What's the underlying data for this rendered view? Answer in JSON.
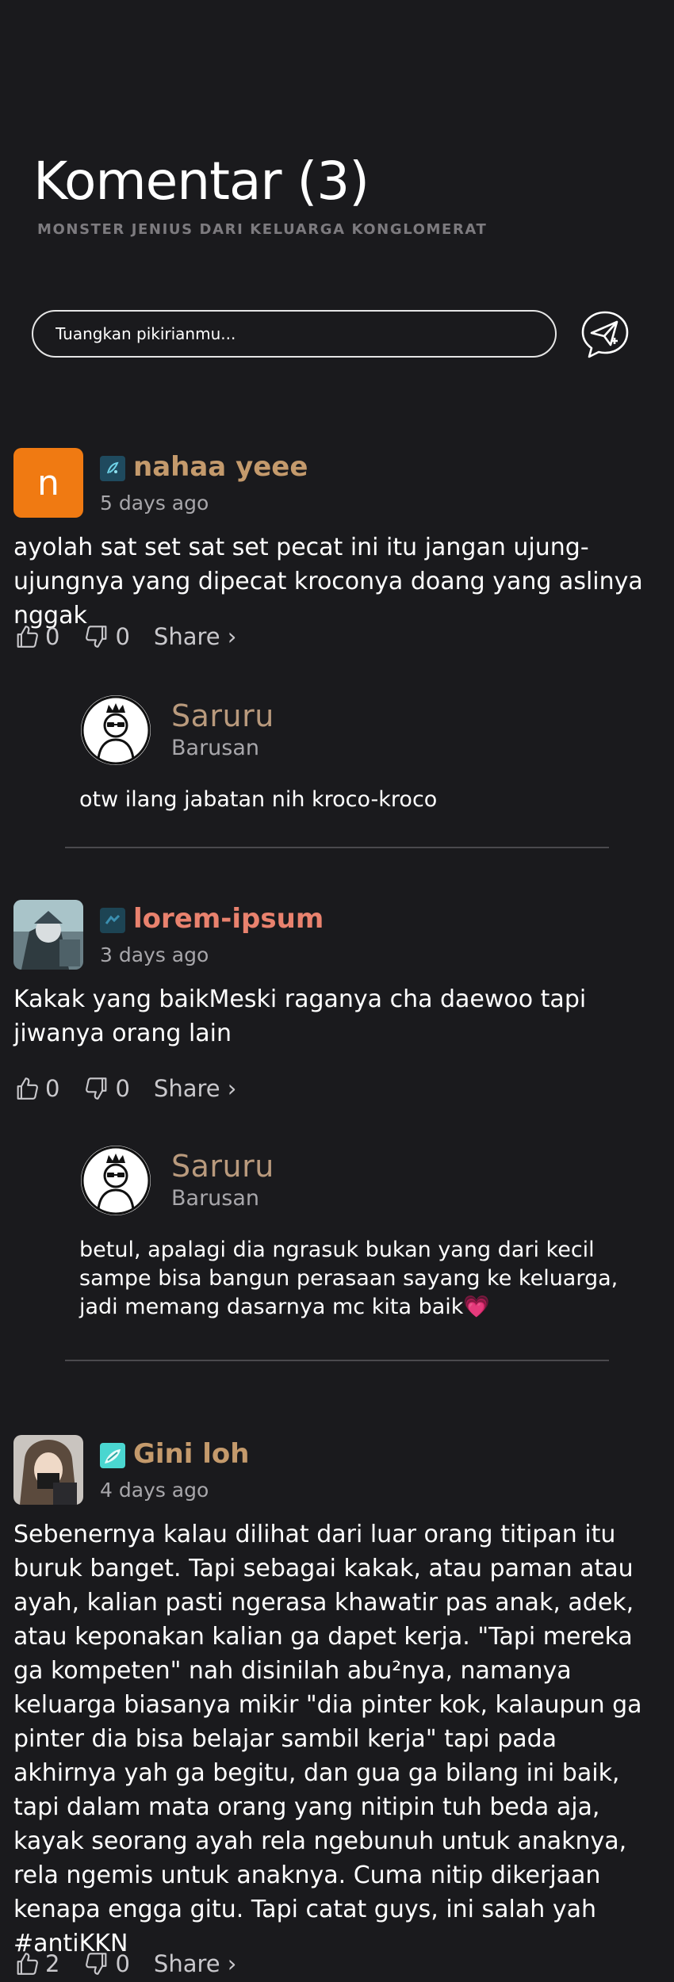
{
  "header": {
    "title": "Komentar (3)",
    "subtitle": "MONSTER JENIUS DARI KELUARGA KONGLOMERAT"
  },
  "composer": {
    "placeholder": "Tuangkan pikirianmu...",
    "send_icon": "send-icon"
  },
  "comments": [
    {
      "avatar_letter": "n",
      "name": "nahaa yeee",
      "name_color": "#c49a6c",
      "time": "5 days ago",
      "text": "ayolah sat set sat set pecat ini itu jangan ujung-ujungnya yang dipecat kroconya doang yang aslinya nggak",
      "likes": "0",
      "dislikes": "0",
      "share": "Share ›",
      "reply": {
        "name": "Saruru",
        "time": "Barusan",
        "text": "otw ilang jabatan nih kroco-kroco"
      }
    },
    {
      "name": "lorem-ipsum",
      "name_color": "#e9826e",
      "time": "3 days ago",
      "text": "Kakak yang baikMeski raganya cha daewoo tapi jiwanya orang lain",
      "likes": "0",
      "dislikes": "0",
      "share": "Share ›",
      "reply": {
        "name": "Saruru",
        "time": "Barusan",
        "text": "betul, apalagi dia ngrasuk bukan yang dari kecil sampe bisa bangun perasaan sayang ke keluarga, jadi memang dasarnya mc kita baik💗"
      }
    },
    {
      "name": "Gini loh",
      "name_color": "#c49a6c",
      "time": "4 days ago",
      "text": "Sebenernya kalau dilihat dari luar orang titipan itu buruk banget. Tapi sebagai kakak, atau paman atau ayah, kalian pasti ngerasa khawatir pas anak, adek, atau keponakan kalian ga dapet kerja. \"Tapi mereka ga kompeten\" nah disinilah abu²nya, namanya keluarga biasanya mikir \"dia pinter kok, kalaupun ga pinter dia bisa belajar sambil kerja\" tapi pada akhirnya yah ga begitu, dan gua ga bilang ini baik, tapi dalam mata orang yang nitipin tuh beda aja, kayak seorang ayah rela ngebunuh untuk anaknya, rela ngemis untuk anaknya. Cuma nitip dikerjaan kenapa engga gitu. Tapi catat guys, ini salah yah #antiKKN",
      "likes": "2",
      "dislikes": "0",
      "share": "Share ›"
    }
  ]
}
